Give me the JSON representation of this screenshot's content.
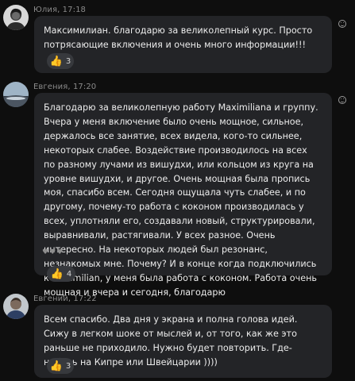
{
  "messages": [
    {
      "author": "Юлия",
      "time": "17:18",
      "text": "Максимилиан. благодарю за великолепный  курс. Просто потрясающие включения и очень много информации!!!",
      "reaction_count": "3",
      "reaction_icon": "thumbs-up-icon"
    },
    {
      "author": "Евгения",
      "time": "17:20",
      "text": "Благодарю за великолепную работу Maximiliana и группу. Вчера у меня включение было очень мощное, сильное, держалось все занятие, всех видела, кого-то сильнее, некоторых слабее. Воздействие производилось на всех по разному лучами из вишудхи, или кольцом из круга на уровне вишудхи, и другое. Очень мощная была пропись моя, спасибо всем. Сегодня ощущала чуть слабее, и по другому, почему-то работа с коконом производилась у всех, уплотняли его, создавали новый, структурировали, выравнивали, растягивали. У всех разное. Очень интересно. На некоторых людей был резонанс, незнакомых мне. Почему? И в конце когда подключились к Maximilian, у меня была работа с коконом. Работа очень мощная и вчера и сегодня, благодарю",
      "hearts": "♥♥♥",
      "reaction_count": "4",
      "reaction_icon": "thumbs-up-icon"
    },
    {
      "author": "Евгений",
      "time": "17:22",
      "text": "Всем спасибо. Два дня у экрана и полна голова идей. Сижу в легком шоке от мыслей и, от того, как же это раньше не приходило. Нужно будет повторить. Где-нибудь на Кипре или Швейцарии ))))",
      "reaction_count": "3",
      "reaction_icon": "thumbs-up-icon"
    }
  ],
  "colors": {
    "background": "#0e0e0e",
    "bubble": "#232427",
    "reaction": "#37393d",
    "meta_text": "#8a8a8a"
  }
}
